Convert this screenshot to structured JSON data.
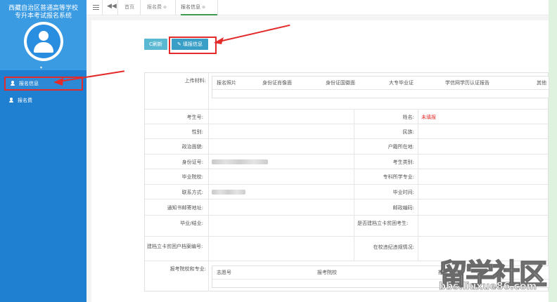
{
  "sidebar": {
    "system_title_line1": "西藏自治区普通高等学校",
    "system_title_line2": "专升本考试报名系统",
    "avatar_caret": "▾",
    "items": [
      {
        "label": "报名信息",
        "icon": "user-icon",
        "active": true
      },
      {
        "label": "报名费",
        "icon": "user-icon",
        "active": false
      }
    ]
  },
  "topbar": {
    "menu_icon": "hamburger-icon",
    "back_icon": "◀◀",
    "tabs": [
      {
        "label": "首页",
        "closable": false,
        "active": false
      },
      {
        "label": "报名费",
        "closable": true,
        "active": false
      },
      {
        "label": "报名信息",
        "closable": true,
        "active": true
      }
    ],
    "close_glyph": "⊗"
  },
  "toolbar": {
    "refresh_label": "C刷新",
    "fill_label": "✎ 填报信息"
  },
  "form": {
    "upload": {
      "label": "上传材料:",
      "columns": [
        "报名照片",
        "身份证肖像面",
        "身份证国徽面",
        "大专毕业证",
        "学信网学历认证报告",
        "其他"
      ]
    },
    "rows": [
      {
        "left_label": "考生号:",
        "left_value": "",
        "right_label": "姓名:",
        "right_value": "未填报"
      },
      {
        "left_label": "性别:",
        "left_value": "",
        "right_label": "民族:",
        "right_value": ""
      },
      {
        "left_label": "政治面貌:",
        "left_value": "",
        "right_label": "户籍所在地:",
        "right_value": ""
      },
      {
        "left_label": "身份证号:",
        "left_value": "",
        "right_label": "考生类别:",
        "right_value": ""
      },
      {
        "left_label": "毕业院校:",
        "left_value": "",
        "right_label": "专科所学专业:",
        "right_value": ""
      },
      {
        "left_label": "联系方式:",
        "left_value": "",
        "right_label": "毕业时间:",
        "right_value": ""
      },
      {
        "left_label": "通知书邮寄地址:",
        "left_value": "",
        "right_label": "邮政编码:",
        "right_value": ""
      },
      {
        "left_label": "毕业/结业:",
        "left_value": "",
        "right_label": "是否建档立卡贫困考生:",
        "right_value": ""
      },
      {
        "left_label": "建档立卡贫困户档案编号:",
        "left_value": "",
        "right_label": "在校违纪违规情况:",
        "right_value": ""
      }
    ],
    "apply": {
      "label": "报考院校和专业:",
      "columns": [
        "志愿号",
        "报考院校",
        "报考专业"
      ]
    }
  },
  "watermark": {
    "main": "留学社区",
    "url": "bbs.liuxue86.com"
  },
  "colors": {
    "sidebar": "#1f7fd1",
    "annotation_red": "#e32b2b",
    "button": "#5bb8d3",
    "active_tab": "#3b9a4e"
  }
}
